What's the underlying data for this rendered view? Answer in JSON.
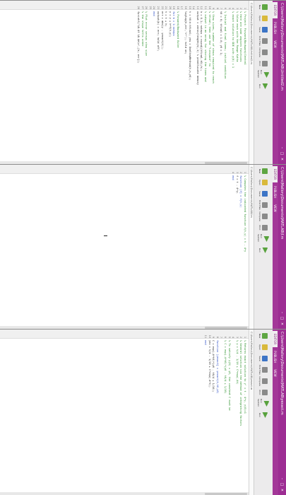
{
  "windows": [
    {
      "title": "C:\\Users\\Mallory\\Documents\\MATLAB\\Untitled2.m",
      "tabs": [
        "EDITOR",
        "PUBLISH",
        "VIEW"
      ],
      "active_tab": 0,
      "ribbon": [
        "New",
        "Open",
        "Save",
        "Find Files",
        "Compare",
        "Print",
        "Run Section",
        "Run"
      ],
      "lines": [
        {
          "n": "1",
          "code": "% Project: Forward/Backward/Central",
          "cls": "cm"
        },
        {
          "n": "2",
          "code": "% Here are some ungiven functions",
          "cls": "cm"
        },
        {
          "n": "3",
          "code": "% Solve each with the Runge Kutta",
          "cls": "cm"
        },
        {
          "n": "4",
          "code": "% exact solution to ODE with y(0) = 1",
          "cls": "cm"
        },
        {
          "n": "5",
          "code": "",
          "cls": ""
        },
        {
          "n": "6",
          "code": "% Initial and final times; initial condition",
          "cls": "cm"
        },
        {
          "n": "7",
          "code": "t0 = 0; tfinal = 1.0; y0 = 1;",
          "cls": ""
        },
        {
          "n": "8",
          "code": "",
          "cls": ""
        },
        {
          "n": "9",
          "code": "% Step sizes, number of steps required to reach",
          "cls": "cm"
        },
        {
          "n": "10",
          "code": "% tfinal; then use the \"linspace\" to",
          "cls": "cm"
        },
        {
          "n": "11",
          "code": "% output in an array for storing the times and",
          "cls": "cm"
        },
        {
          "n": "12",
          "code": "h = 0.1; nsteps = round((tfinal-t0)/h);",
          "cls": ""
        },
        {
          "n": "13",
          "code": "output = zeros(length(h),1) % preallocate memory",
          "cls": ""
        },
        {
          "n": "14",
          "code": "",
          "cls": ""
        },
        {
          "n": "15",
          "code": "t = t0:h:tfinal; yeu = OneStepMethod(t,h,y0);",
          "cls": ""
        },
        {
          "n": "16",
          "code": "loglog(h,err,'r*'); hold on;",
          "cls": ""
        },
        {
          "n": "17",
          "code": "",
          "cls": ""
        },
        {
          "n": "18",
          "code": "% Forward/Backward Euler",
          "cls": "cm"
        },
        {
          "n": "19",
          "code": "for k = 1:nsteps",
          "cls": "kw"
        },
        {
          "n": "20",
          "code": "  y = y + h*f(t,y);",
          "cls": ""
        },
        {
          "n": "21",
          "code": "  t = t + h;",
          "cls": ""
        },
        {
          "n": "22",
          "code": "  err = abs(y - yexact(t));",
          "cls": ""
        },
        {
          "n": "23",
          "code": "  output(k) = err; hold off;",
          "cls": ""
        },
        {
          "n": "24",
          "code": "end",
          "cls": "kw"
        },
        {
          "n": "25",
          "code": "",
          "cls": ""
        },
        {
          "n": "26",
          "code": "% Plot error versus step size",
          "cls": "cm"
        },
        {
          "n": "27",
          "code": "% the slope tells order",
          "cls": "cm"
        },
        {
          "n": "28",
          "code": "fprintf('%8.4f %8.4e\\n',[h; err]);",
          "cls": ""
        }
      ]
    },
    {
      "title": "C:\\Users\\Mallory\\Documents\\MATLAB\\f.m",
      "tabs": [
        "EDITOR",
        "PUBLISH",
        "VIEW"
      ],
      "active_tab": 0,
      "ribbon": [
        "New",
        "Open",
        "Save",
        "Find Files",
        "Compare",
        "Print",
        "Run Section",
        "Run"
      ],
      "lines": [
        {
          "n": "1",
          "code": "% Computes the indicated function f(t,y) = t - 4*y",
          "cls": "cm"
        },
        {
          "n": "2",
          "code": "function [f] = f(t,y)",
          "cls": "kw"
        },
        {
          "n": "3",
          "code": "  f = t - 4*y;",
          "cls": ""
        },
        {
          "n": "4",
          "code": "end",
          "cls": "kw"
        }
      ]
    },
    {
      "title": "C:\\Users\\Mallory\\Documents\\MATLAB\\yexact.m",
      "tabs": [
        "EDITOR",
        "PUBLISH",
        "VIEW"
      ],
      "active_tab": 0,
      "ribbon": [
        "New",
        "Open",
        "Save",
        "Find Files",
        "Compare",
        "Print",
        "Run Section",
        "Run"
      ],
      "lines": [
        {
          "n": "1",
          "code": "% Returns exact solution to y' = t - 4*y, y(0)=1",
          "cls": "cm"
        },
        {
          "n": "2",
          "code": "% General solution via the method of integrating factors",
          "cls": "cm"
        },
        {
          "n": "3",
          "code": "% y = t/4 - 1/16 + C*exp(-4t)",
          "cls": "cm"
        },
        {
          "n": "4",
          "code": "",
          "cls": ""
        },
        {
          "n": "5",
          "code": "% To satisfy y(0) = y0, the constant C must be",
          "cls": "cm"
        },
        {
          "n": "6",
          "code": "% C = exp(-4*t0)*(y0 - t0/4 + 1/16)",
          "cls": "cm"
        },
        {
          "n": "7",
          "code": "",
          "cls": ""
        },
        {
          "n": "8",
          "code": "function [yexact] = yexact(t,t0,y0)",
          "cls": "kw"
        },
        {
          "n": "9",
          "code": "  C = exp(-4*t0)*(y0 - t0/4 + 1/16);",
          "cls": ""
        },
        {
          "n": "10",
          "code": "  yex = t/4 - 1/16 + C*exp(-4*t);",
          "cls": ""
        },
        {
          "n": "11",
          "code": "end",
          "cls": "kw"
        }
      ]
    }
  ]
}
